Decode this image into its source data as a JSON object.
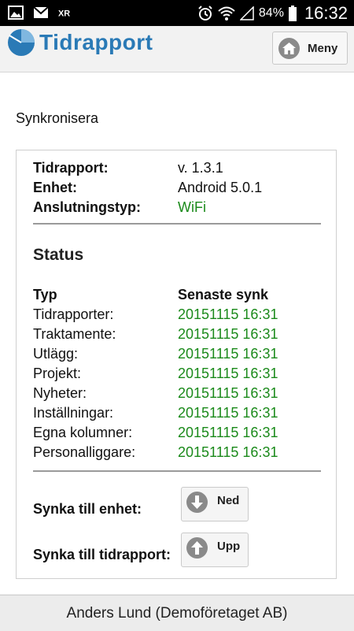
{
  "status_bar": {
    "battery": "84%",
    "time": "16:32",
    "icons": [
      "image-icon",
      "mail-icon",
      "nosignal-icon",
      "alarm-icon",
      "wifi-icon",
      "signal-icon",
      "battery-icon"
    ]
  },
  "header": {
    "logo_text": "Tidrapport",
    "menu_label": "Meny",
    "menu_icon": "home-icon",
    "brand_color": "#2a7ab6"
  },
  "page": {
    "title": "Synkronisera"
  },
  "info": [
    {
      "key": "Tidrapport:",
      "value": "v. 1.3.1"
    },
    {
      "key": "Enhet:",
      "value": "Android 5.0.1"
    },
    {
      "key": "Anslutningstyp:",
      "value": "WiFi"
    }
  ],
  "status": {
    "heading": "Status",
    "col_type": "Typ",
    "col_sync": "Senaste synk",
    "rows": [
      {
        "type": "Tidrapporter:",
        "sync": "20151115 16:31"
      },
      {
        "type": "Traktamente:",
        "sync": "20151115 16:31"
      },
      {
        "type": "Utlägg:",
        "sync": "20151115 16:31"
      },
      {
        "type": "Projekt:",
        "sync": "20151115 16:31"
      },
      {
        "type": "Nyheter:",
        "sync": "20151115 16:31"
      },
      {
        "type": "Inställningar:",
        "sync": "20151115 16:31"
      },
      {
        "type": "Egna kolumner:",
        "sync": "20151115 16:31"
      },
      {
        "type": "Personalliggare:",
        "sync": "20151115 16:31"
      }
    ]
  },
  "sync": {
    "to_device_label": "Synka till enhet:",
    "down_label": "Ned",
    "down_icon": "arrow-down-icon",
    "to_server_label": "Synka till tidrapport:",
    "up_label": "Upp",
    "up_icon": "arrow-up-icon"
  },
  "footer": {
    "user": "Anders Lund (Demoföretaget AB)"
  },
  "colors": {
    "ok_green": "#1b8a1b"
  }
}
